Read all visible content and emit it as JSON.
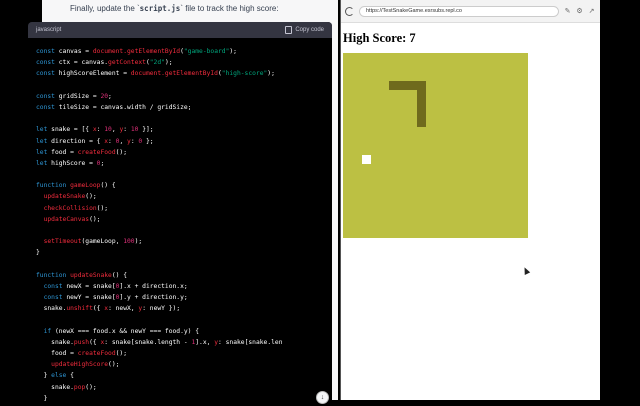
{
  "chat": {
    "intro_prefix": "Finally, update the `",
    "intro_file": "script.js",
    "intro_suffix": "` file to track the high score:",
    "code_language": "javascript",
    "copy_label": "Copy code",
    "scroll_down_icon": "arrow-down-icon"
  },
  "code_lines": [
    [
      [
        "k",
        "const "
      ],
      [
        "v",
        "canvas = "
      ],
      [
        "f",
        "document.getElementById"
      ],
      [
        "v",
        "("
      ],
      [
        "s",
        "\"game-board\""
      ],
      [
        "v",
        ");"
      ]
    ],
    [
      [
        "k",
        "const "
      ],
      [
        "v",
        "ctx = canvas."
      ],
      [
        "f",
        "getContext"
      ],
      [
        "v",
        "("
      ],
      [
        "s",
        "\"2d\""
      ],
      [
        "v",
        ");"
      ]
    ],
    [
      [
        "k",
        "const "
      ],
      [
        "v",
        "highScoreElement = "
      ],
      [
        "f",
        "document.getElementById"
      ],
      [
        "v",
        "("
      ],
      [
        "s",
        "\"high-score\""
      ],
      [
        "v",
        ");"
      ]
    ],
    [],
    [
      [
        "k",
        "const "
      ],
      [
        "v",
        "gridSize = "
      ],
      [
        "n",
        "20"
      ],
      [
        "v",
        ";"
      ]
    ],
    [
      [
        "k",
        "const "
      ],
      [
        "v",
        "tileSize = canvas.width / gridSize;"
      ]
    ],
    [],
    [
      [
        "k",
        "let "
      ],
      [
        "v",
        "snake = [{ "
      ],
      [
        "f",
        "x"
      ],
      [
        "v",
        ": "
      ],
      [
        "n",
        "10"
      ],
      [
        "v",
        ", "
      ],
      [
        "f",
        "y"
      ],
      [
        "v",
        ": "
      ],
      [
        "n",
        "10"
      ],
      [
        "v",
        " }];"
      ]
    ],
    [
      [
        "k",
        "let "
      ],
      [
        "v",
        "direction = { "
      ],
      [
        "f",
        "x"
      ],
      [
        "v",
        ": "
      ],
      [
        "n",
        "0"
      ],
      [
        "v",
        ", "
      ],
      [
        "f",
        "y"
      ],
      [
        "v",
        ": "
      ],
      [
        "n",
        "0"
      ],
      [
        "v",
        " };"
      ]
    ],
    [
      [
        "k",
        "let "
      ],
      [
        "v",
        "food = "
      ],
      [
        "f",
        "createFood"
      ],
      [
        "v",
        "();"
      ]
    ],
    [
      [
        "k",
        "let "
      ],
      [
        "v",
        "highScore = "
      ],
      [
        "n",
        "0"
      ],
      [
        "v",
        ";"
      ]
    ],
    [],
    [
      [
        "k",
        "function "
      ],
      [
        "f",
        "gameLoop"
      ],
      [
        "v",
        "() {"
      ]
    ],
    [
      [
        "v",
        "  "
      ],
      [
        "f",
        "updateSnake"
      ],
      [
        "v",
        "();"
      ]
    ],
    [
      [
        "v",
        "  "
      ],
      [
        "f",
        "checkCollision"
      ],
      [
        "v",
        "();"
      ]
    ],
    [
      [
        "v",
        "  "
      ],
      [
        "f",
        "updateCanvas"
      ],
      [
        "v",
        "();"
      ]
    ],
    [],
    [
      [
        "v",
        "  "
      ],
      [
        "f",
        "setTimeout"
      ],
      [
        "v",
        "(gameLoop, "
      ],
      [
        "n",
        "100"
      ],
      [
        "v",
        ");"
      ]
    ],
    [
      [
        "v",
        "}"
      ]
    ],
    [],
    [
      [
        "k",
        "function "
      ],
      [
        "f",
        "updateSnake"
      ],
      [
        "v",
        "() {"
      ]
    ],
    [
      [
        "v",
        "  "
      ],
      [
        "k",
        "const "
      ],
      [
        "v",
        "newX = snake["
      ],
      [
        "n",
        "0"
      ],
      [
        "v",
        "].x + direction.x;"
      ]
    ],
    [
      [
        "v",
        "  "
      ],
      [
        "k",
        "const "
      ],
      [
        "v",
        "newY = snake["
      ],
      [
        "n",
        "0"
      ],
      [
        "v",
        "].y + direction.y;"
      ]
    ],
    [
      [
        "v",
        "  snake."
      ],
      [
        "f",
        "unshift"
      ],
      [
        "v",
        "({ "
      ],
      [
        "f",
        "x"
      ],
      [
        "v",
        ": newX, "
      ],
      [
        "f",
        "y"
      ],
      [
        "v",
        ": newY });"
      ]
    ],
    [],
    [
      [
        "v",
        "  "
      ],
      [
        "k",
        "if "
      ],
      [
        "v",
        "(newX === food.x && newY === food.y) {"
      ]
    ],
    [
      [
        "v",
        "    snake."
      ],
      [
        "f",
        "push"
      ],
      [
        "v",
        "({ "
      ],
      [
        "f",
        "x"
      ],
      [
        "v",
        ": snake[snake.length - "
      ],
      [
        "n",
        "1"
      ],
      [
        "v",
        "].x, "
      ],
      [
        "f",
        "y"
      ],
      [
        "v",
        ": snake[snake.len"
      ]
    ],
    [
      [
        "v",
        "    food = "
      ],
      [
        "f",
        "createFood"
      ],
      [
        "v",
        "();"
      ]
    ],
    [
      [
        "v",
        "    "
      ],
      [
        "f",
        "updateHighScore"
      ],
      [
        "v",
        "();"
      ]
    ],
    [
      [
        "v",
        "  } "
      ],
      [
        "k",
        "else "
      ],
      [
        "v",
        "{"
      ]
    ],
    [
      [
        "v",
        "    snake."
      ],
      [
        "f",
        "pop"
      ],
      [
        "v",
        "();"
      ]
    ],
    [
      [
        "v",
        "  }"
      ]
    ]
  ],
  "browser": {
    "url": "https://TestSnakeGame.esrsubs.repl.co",
    "reload_icon": "reload-icon",
    "toolbar_icons": [
      "pencil-icon",
      "wrench-icon",
      "external-link-icon"
    ],
    "high_score_text": "High Score: 7"
  },
  "game": {
    "grid": 20,
    "board_color": "#bcc043",
    "snake_color": "#6f6a1d",
    "food_color": "#ffffff",
    "snake_segments": [
      {
        "col": 5,
        "row": 3
      },
      {
        "col": 6,
        "row": 3
      },
      {
        "col": 7,
        "row": 3
      },
      {
        "col": 8,
        "row": 3
      },
      {
        "col": 8,
        "row": 4
      },
      {
        "col": 8,
        "row": 5
      },
      {
        "col": 8,
        "row": 6
      },
      {
        "col": 8,
        "row": 7
      }
    ],
    "food": {
      "col": 2,
      "row": 11
    }
  }
}
